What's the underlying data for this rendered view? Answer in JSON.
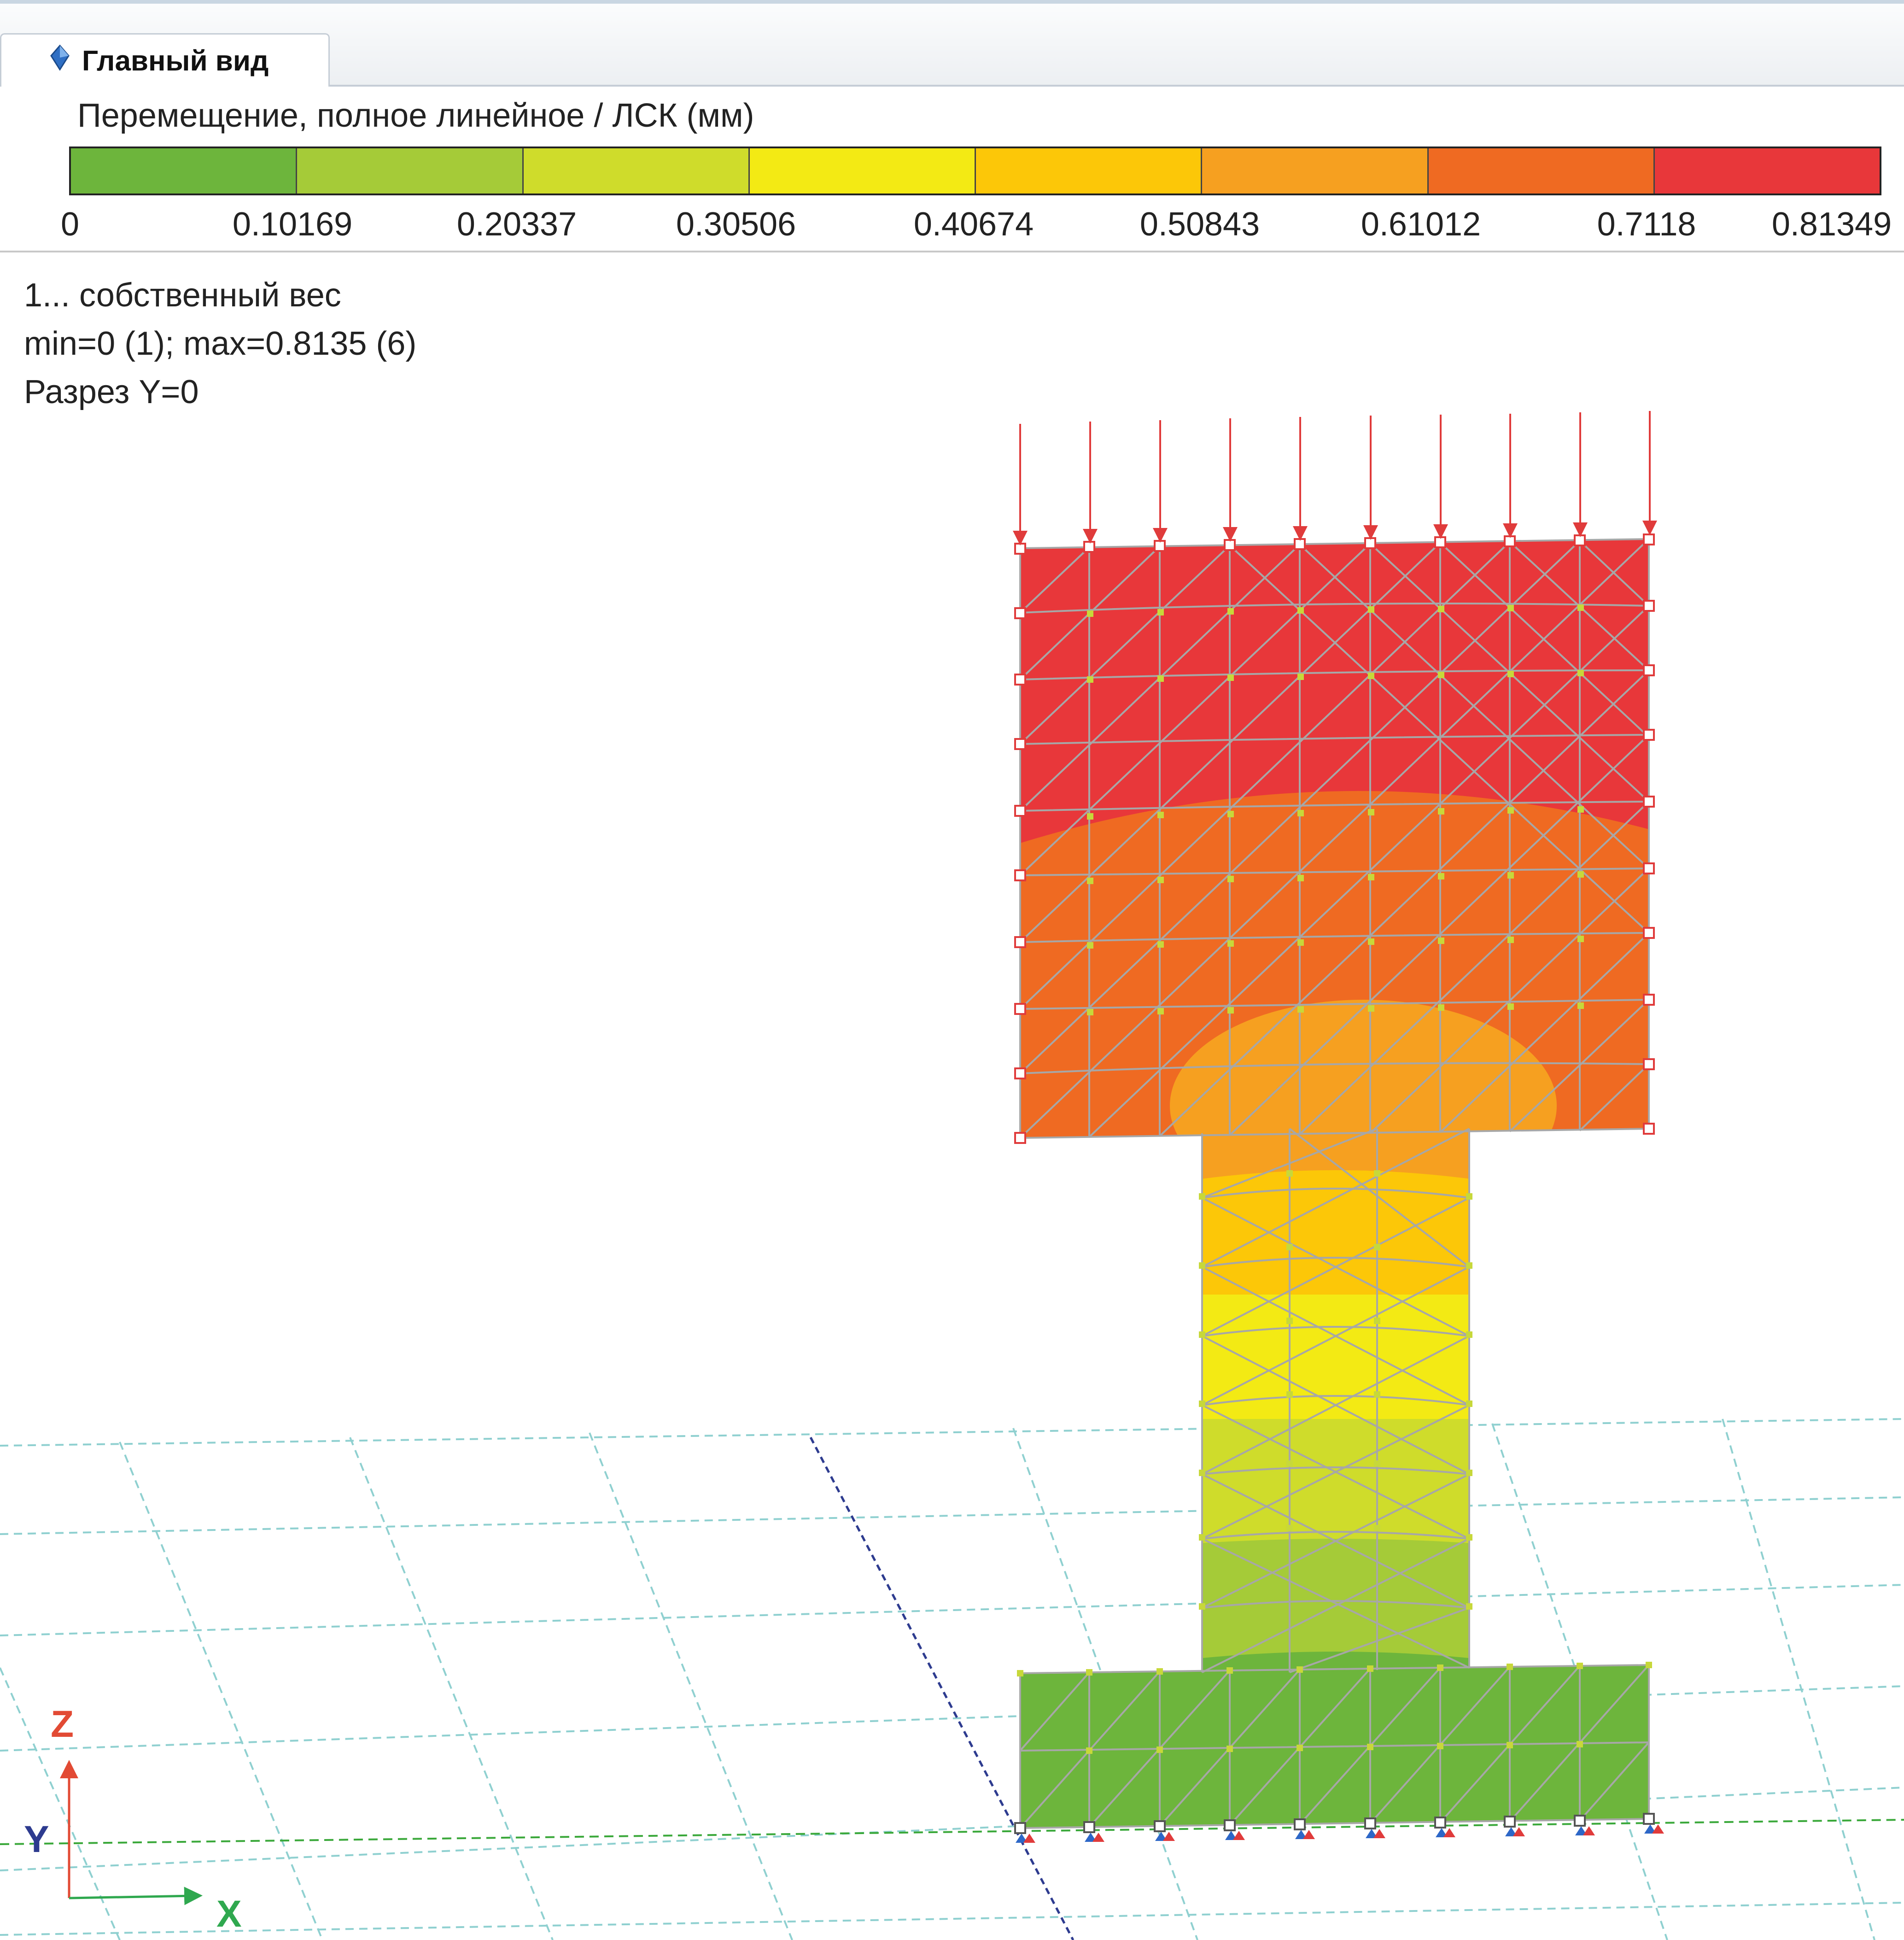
{
  "tab": {
    "label": "Главный вид",
    "icon": "diamond-icon"
  },
  "legend": {
    "title": "Перемещение, полное линейное / ЛСК (мм)",
    "colors": [
      "#6db53c",
      "#a5cb38",
      "#cfdc2b",
      "#f3ea14",
      "#fcc708",
      "#f6a020",
      "#ef6a22",
      "#e8373a"
    ],
    "ticks": [
      "0",
      "0.10169",
      "0.20337",
      "0.30506",
      "0.40674",
      "0.50843",
      "0.61012",
      "0.7118",
      "0.81349"
    ]
  },
  "info": {
    "load_case": "1... собственный вес",
    "min_max": "min=0 (1); max=0.8135 (6)",
    "section": "Разрез Y=0"
  },
  "axes": {
    "z": "Z",
    "y": "Y",
    "x": "X"
  }
}
